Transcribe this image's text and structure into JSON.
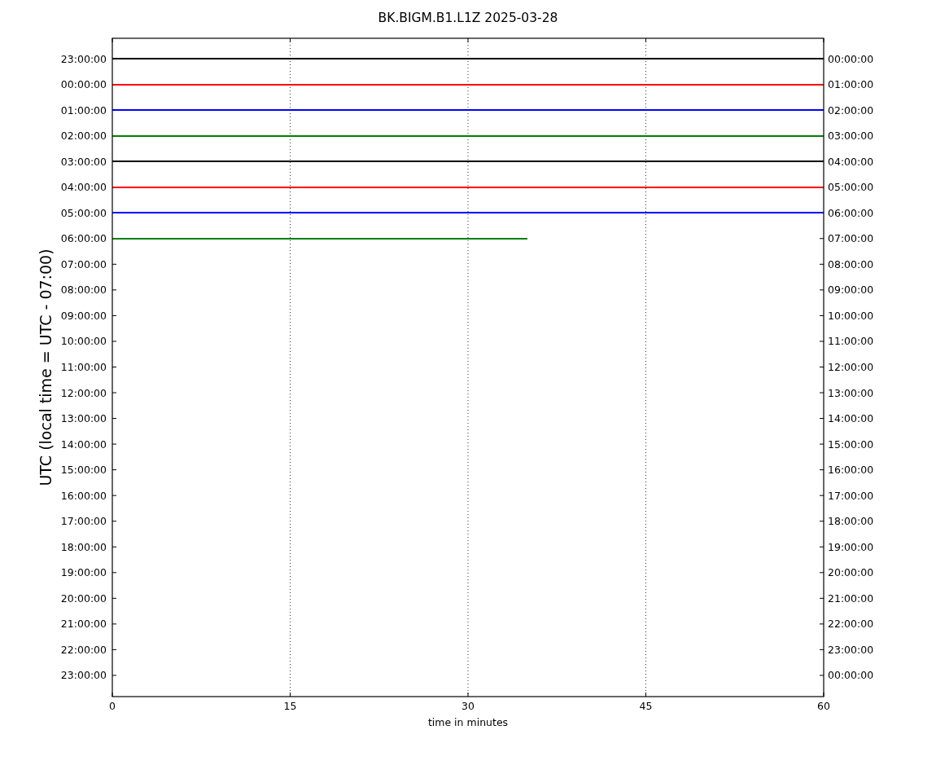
{
  "plot": {
    "title": "BK.BIGM.B1.L1Z 2025-03-28",
    "x_axis_title": "time in minutes",
    "y_axis_title": "UTC (local time = UTC - 07:00)",
    "x_tick_labels": [
      "0",
      "15",
      "30",
      "45",
      "60"
    ],
    "left_axis_labels": [
      "23:00:00",
      "00:00:00",
      "01:00:00",
      "02:00:00",
      "03:00:00",
      "04:00:00",
      "05:00:00",
      "06:00:00",
      "07:00:00",
      "08:00:00",
      "09:00:00",
      "10:00:00",
      "11:00:00",
      "12:00:00",
      "13:00:00",
      "14:00:00",
      "15:00:00",
      "16:00:00",
      "17:00:00",
      "18:00:00",
      "19:00:00",
      "20:00:00",
      "21:00:00",
      "22:00:00",
      "23:00:00"
    ],
    "right_axis_labels": [
      "00:00:00",
      "01:00:00",
      "02:00:00",
      "03:00:00",
      "04:00:00",
      "05:00:00",
      "06:00:00",
      "07:00:00",
      "08:00:00",
      "09:00:00",
      "10:00:00",
      "11:00:00",
      "12:00:00",
      "13:00:00",
      "14:00:00",
      "15:00:00",
      "16:00:00",
      "17:00:00",
      "18:00:00",
      "19:00:00",
      "20:00:00",
      "21:00:00",
      "22:00:00",
      "23:00:00",
      "00:00:00"
    ],
    "traces": [
      {
        "kind": "full",
        "color": "#000000"
      },
      {
        "kind": "full",
        "color": "#ff0000"
      },
      {
        "kind": "full",
        "color": "#0000ff"
      },
      {
        "kind": "full",
        "color": "#008000"
      },
      {
        "kind": "full",
        "color": "#000000"
      },
      {
        "kind": "full",
        "color": "#ff0000"
      },
      {
        "kind": "full",
        "color": "#0000ff"
      },
      {
        "kind": "partial",
        "color": "#008000"
      }
    ]
  }
}
